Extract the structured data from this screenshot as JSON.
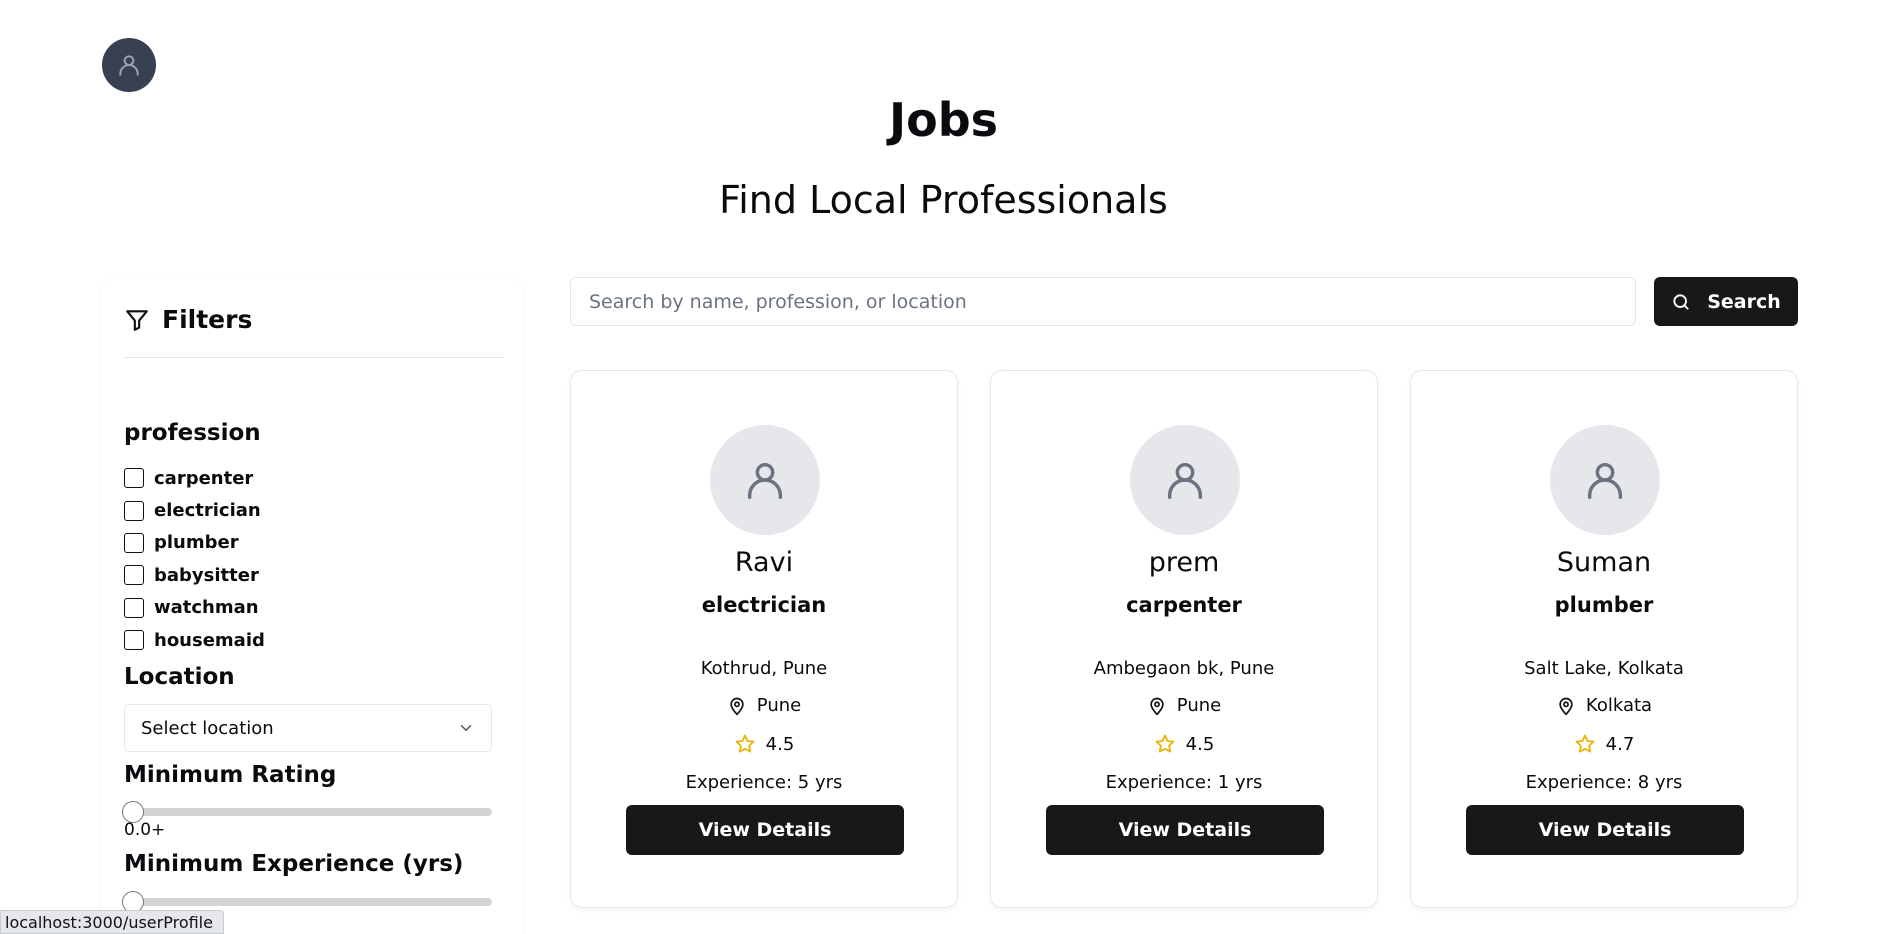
{
  "header": {
    "title": "Jobs",
    "subtitle": "Find Local Professionals",
    "avatar_icon": "user-icon"
  },
  "filters": {
    "title": "Filters",
    "icon": "filter-icon",
    "profession_title": "profession",
    "professions": [
      "carpenter",
      "electrician",
      "plumber",
      "babysitter",
      "watchman",
      "housemaid"
    ],
    "location_title": "Location",
    "location_selected": "Select location",
    "rating_title": "Minimum Rating",
    "rating_value_label": "0.0+",
    "rating_value": 0,
    "experience_title": "Minimum Experience (yrs)",
    "experience_value": 0
  },
  "search": {
    "placeholder": "Search by name, profession, or location",
    "button_label": "Search"
  },
  "professionals": [
    {
      "name": "Ravi",
      "profession": "electrician",
      "address": "Kothrud, Pune",
      "city": "Pune",
      "rating": "4.5",
      "experience": "Experience: 5 yrs",
      "button": "View Details"
    },
    {
      "name": "prem",
      "profession": "carpenter",
      "address": "Ambegaon bk, Pune",
      "city": "Pune",
      "rating": "4.5",
      "experience": "Experience: 1 yrs",
      "button": "View Details"
    },
    {
      "name": "Suman",
      "profession": "plumber",
      "address": "Salt Lake, Kolkata",
      "city": "Kolkata",
      "rating": "4.7",
      "experience": "Experience: 8 yrs",
      "button": "View Details"
    }
  ],
  "status_bar": {
    "url": "localhost:3000/userProfile"
  },
  "colors": {
    "primary": "#18181b",
    "star": "#eab308",
    "avatar_bg": "#374151",
    "card_avatar_bg": "#e5e7eb"
  }
}
